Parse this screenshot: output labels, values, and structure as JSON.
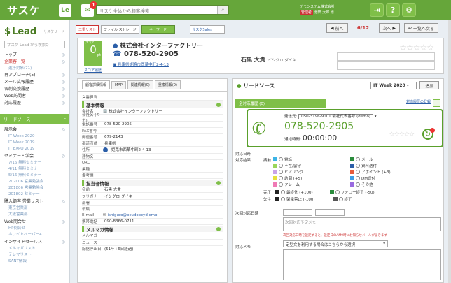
{
  "topbar": {
    "logo": "サスケ",
    "lead_icon": "Le",
    "notify_count": "1",
    "search_placeholder": "サスケ全体から顧客検索",
    "user_company": "デモシステム株式会社",
    "user_badge": "管理者",
    "user_name": "池田 太郎 様"
  },
  "sidebar": {
    "app_title": "Lead",
    "app_sub": "サスケリード",
    "search_placeholder": "サスケ Lead から検索Q",
    "items": [
      {
        "label": "トップ"
      },
      {
        "label": "企業客一覧",
        "red": true
      },
      {
        "label": "進捗対象(71)",
        "sub": true
      },
      {
        "label": "再アプローチ(5)"
      },
      {
        "label": "メール広報履歴"
      },
      {
        "label": "名刺交換履歴"
      },
      {
        "label": "Web訪問者"
      },
      {
        "label": "対応履歴"
      }
    ],
    "section_label": "リードソース",
    "lead_items": [
      {
        "label": "展示会",
        "group": true
      },
      {
        "label": "IT Week 2020",
        "sub": true
      },
      {
        "label": "IT Week 2019",
        "sub": true
      },
      {
        "label": "IT EXPO 2019",
        "sub": true
      },
      {
        "label": "セミナー・学会",
        "group": true
      },
      {
        "label": "7/16 無料セミナー",
        "sub": true
      },
      {
        "label": "4/11 無料セミナー",
        "sub": true
      },
      {
        "label": "5/16 無料セミナー",
        "sub": true
      },
      {
        "label": "202006 営業勉強会",
        "sub": true
      },
      {
        "label": "201806 営業勉強会",
        "sub": true
      },
      {
        "label": "201802 セミナー",
        "sub": true
      },
      {
        "label": "購入顧客 営業リスト",
        "group": true
      },
      {
        "label": "東京営業部",
        "sub": true
      },
      {
        "label": "大阪営業部",
        "sub": true
      },
      {
        "label": "Web問合せ",
        "group": true
      },
      {
        "label": "HP問合せ",
        "sub": true
      },
      {
        "label": "ホワイトペーパーA",
        "sub": true
      },
      {
        "label": "インサイドセールス",
        "group": true
      },
      {
        "label": "メルマガリスト",
        "sub": true
      },
      {
        "label": "テレマリスト",
        "sub": true
      },
      {
        "label": "SANT情報",
        "sub": true
      }
    ]
  },
  "page_header": {
    "tabs": [
      "二重リスト",
      "ファイル ストレージ",
      "キーワード",
      "サスケSales"
    ],
    "prev": "前へ",
    "page": "6/12",
    "next": "次へ",
    "back": "一覧へ戻る"
  },
  "customer": {
    "score_label": "スコア",
    "score": "0",
    "score_unit": "pt",
    "score_link": "スコア履歴",
    "company": "株式会社インターファクトリー",
    "phone": "078-520-2905",
    "address": "兵庫県姫路市西華中町2-4-13",
    "person": "石黒 大貴",
    "person_kana": "イシグロ ダイキ"
  },
  "left_panel": {
    "tabs": [
      "顧客詳細情報",
      "MAP",
      "関連情報(0)",
      "重複情報(0)"
    ],
    "field_rows": [
      {
        "label": "営業担当",
        "value": ""
      }
    ],
    "section_basic": "基本情報",
    "basic": [
      {
        "label": "会社名",
        "value": "株式会社インターファクトリー"
      },
      {
        "label": "会社名 (カナ)",
        "value": ""
      },
      {
        "label": "電話番号",
        "value": "078-520-2905"
      },
      {
        "label": "FAX番号",
        "value": ""
      },
      {
        "label": "郵便番号",
        "value": "679-2143"
      },
      {
        "label": "都道府県",
        "value": "兵庫県"
      },
      {
        "label": "住所",
        "value": "姫路市西華中町2-4-13"
      },
      {
        "label": "建物名",
        "value": ""
      },
      {
        "label": "URL",
        "value": ""
      },
      {
        "label": "業種",
        "value": ""
      },
      {
        "label": "備考欄",
        "value": ""
      }
    ],
    "section_contact": "担当者情報",
    "contact": [
      {
        "label": "名前",
        "value": "石黒 大貴"
      },
      {
        "label": "フリガナ",
        "value": "イシグロ ダイキ"
      },
      {
        "label": "部署",
        "value": ""
      },
      {
        "label": "役職",
        "value": ""
      },
      {
        "label": "E-mail",
        "value": "ishiguro@ocudoocyd.cmb"
      },
      {
        "label": "携帯電話",
        "value": "090-8366-0711"
      }
    ],
    "section_mail": "メルマガ情報",
    "mail": [
      {
        "label": "メルマガ",
        "value": ""
      },
      {
        "label": "ニュース",
        "value": ""
      },
      {
        "label": "配信停止日",
        "value": "(51年+6日経過)"
      }
    ]
  },
  "right_panel": {
    "title": "リードソース",
    "campaign": "IT Week 2020",
    "campaign_btn": "追加",
    "tab": "全対応履歴 (0)",
    "history_link": "対応履歴の登録",
    "call": {
      "from_label": "発信元:",
      "from_value": "050-3196-9001 会社代表番号 (demo)",
      "number": "078-520-2905",
      "duration_label": "通話時間:",
      "duration": "00:00:00"
    },
    "response_label": "対応結果",
    "response_date_label": "対応日時",
    "method_label": "接触",
    "methods": [
      "電話",
      "不在/留守",
      "ヒアリング",
      "訪問 (+5)",
      "クレーム"
    ],
    "methods_right": [
      "メール",
      "資料送付",
      "アポイント (+3)",
      "DM送付",
      "その他"
    ],
    "done_label": "完了",
    "done1": "最終化 (+100)",
    "done2": "フォロー終了 (-50)",
    "lost_label": "失注",
    "lost": "架電禁止 (-100)",
    "lost2": "終了",
    "next_label": "次回対応日時",
    "memo_placeholder": "次回対応予定メモ",
    "memo_note": "次回対応日時を設定すると、設定日のAM9時にお知らせメールが届きます",
    "note_label": "対応メモ",
    "note_select": "定型文を利用する場合はこちらから選択"
  }
}
